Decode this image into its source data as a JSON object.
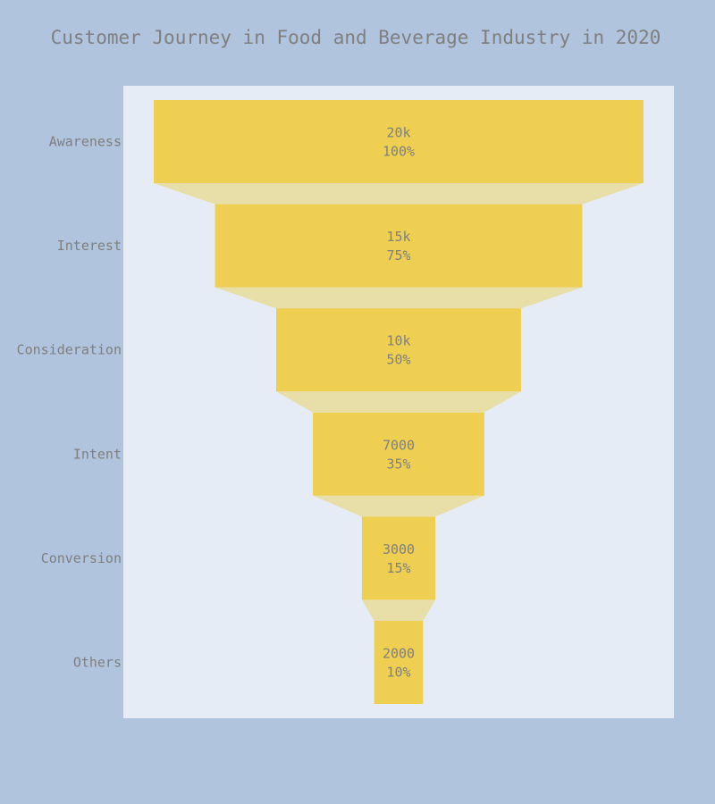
{
  "chart_data": {
    "type": "funnel",
    "title": "Customer Journey in Food and Beverage Industry in 2020",
    "stages": [
      "Awareness",
      "Interest",
      "Consideration",
      "Intent",
      "Conversion",
      "Others"
    ],
    "values": [
      20000,
      15000,
      10000,
      7000,
      3000,
      2000
    ],
    "value_labels": [
      "20k",
      "15k",
      "10k",
      "7000",
      "3000",
      "2000"
    ],
    "percent_labels": [
      "100%",
      "75%",
      "50%",
      "35%",
      "15%",
      "10%"
    ],
    "colors": {
      "page_background": "#b0c4de",
      "plot_background": "#e6ecf6",
      "bar": "#eecf52",
      "connector": "#e8dea8",
      "text": "#7f7f7f"
    }
  }
}
